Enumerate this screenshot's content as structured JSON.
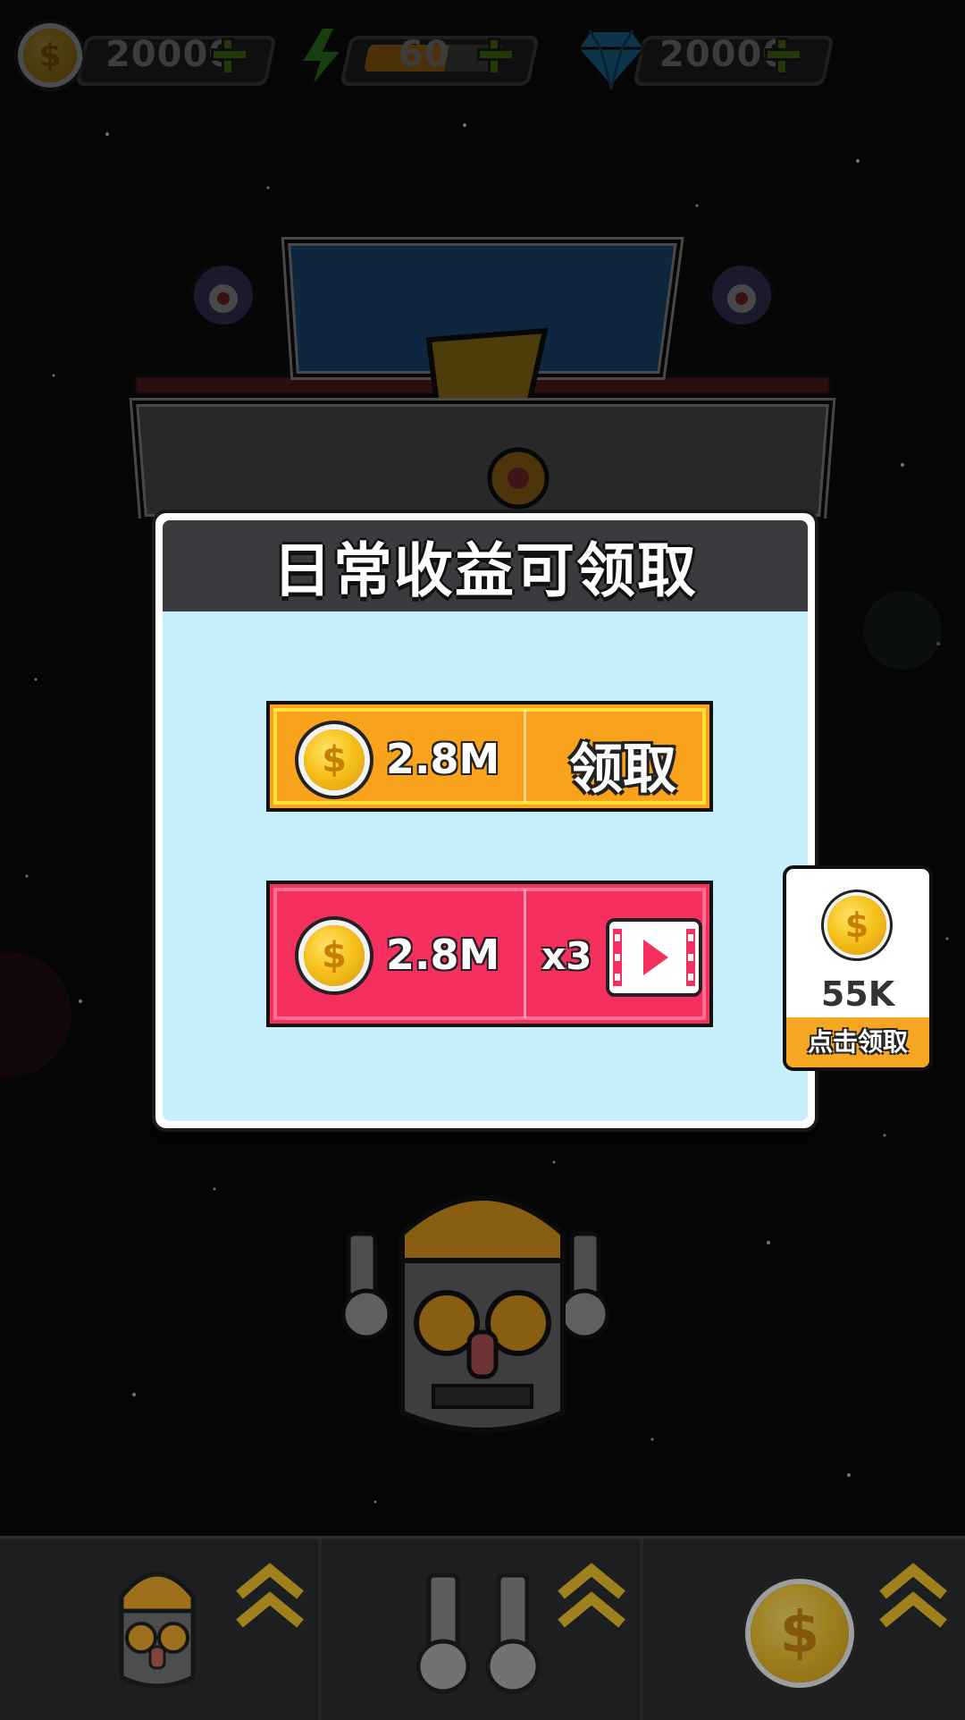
{
  "hud": {
    "coins": "20000",
    "energy": "60",
    "energy_level": 0.6,
    "gems": "20000"
  },
  "dialog": {
    "title": "日常收益可领取",
    "option1": {
      "amount": "2.8M",
      "label": "领取"
    },
    "option2": {
      "amount": "2.8M",
      "multiplier": "x3"
    }
  },
  "side_reward": {
    "amount": "55K",
    "label": "点击领取"
  },
  "colors": {
    "orange": "#f9a21b",
    "red": "#f5305f",
    "panel_bg": "#c8f0fc",
    "header": "#3a3b3e"
  }
}
